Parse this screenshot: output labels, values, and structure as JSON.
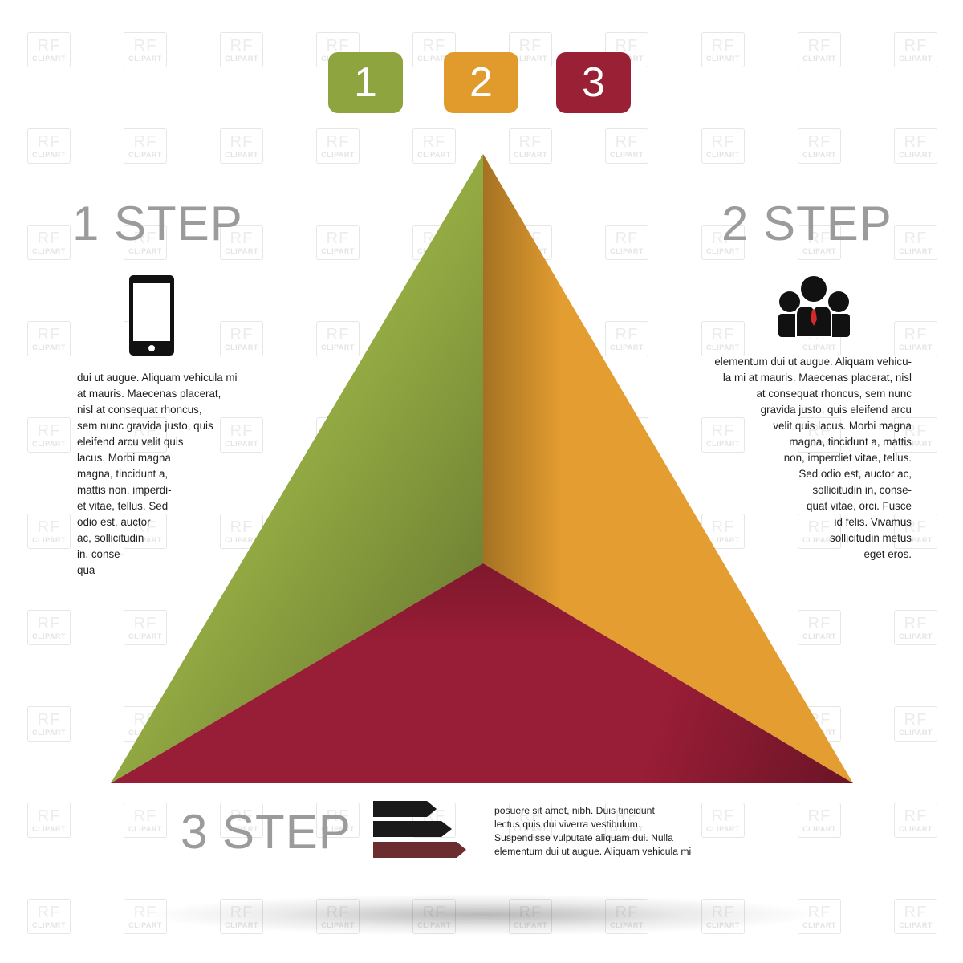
{
  "watermark": {
    "top": "RF",
    "bottom": "CLIPART"
  },
  "badges": [
    {
      "label": "1",
      "color": "#8ea43e"
    },
    {
      "label": "2",
      "color": "#e19b2c"
    },
    {
      "label": "3",
      "color": "#9a2035"
    }
  ],
  "pyramid": {
    "colors": {
      "green": "#93aa43",
      "orange": "#e39d30",
      "red": "#981d36"
    }
  },
  "steps": {
    "step1": {
      "title": "1 STEP",
      "icon": "smartphone-icon",
      "text": "dui ut augue. Aliquam vehicula mi\nat mauris. Maecenas placerat,\nnisl at consequat rhoncus,\nsem nunc gravida justo, quis\neleifend arcu velit quis\nlacus. Morbi magna\nmagna, tincidunt a,\nmattis non, imperdi-\net vitae, tellus. Sed\nodio est, auctor\nac, sollicitudin\nin, conse-\n    qua"
    },
    "step2": {
      "title": "2 STEP",
      "icon": "team-people-icon",
      "text": "elementum dui ut augue. Aliquam vehicu-\nla mi at mauris. Maecenas placerat, nisl\nat consequat rhoncus, sem nunc\ngravida justo, quis eleifend arcu\nvelit quis lacus. Morbi magna\nmagna, tincidunt a, mattis\nnon, imperdiet vitae, tellus.\nSed odio est, auctor ac,\nsollicitudin in, conse-\nquat vitae, orci. Fusce\nid felis. Vivamus\nsollicitudin metus\neget eros."
    },
    "step3": {
      "title": "3 STEP",
      "icon": "stacked-arrows-icon",
      "text": "posuere sit amet, nibh. Duis tincidunt\nlectus quis dui viverra vestibulum.\nSuspendisse vulputate aliquam dui. Nulla\nelementum dui ut augue. Aliquam vehicula mi"
    }
  }
}
